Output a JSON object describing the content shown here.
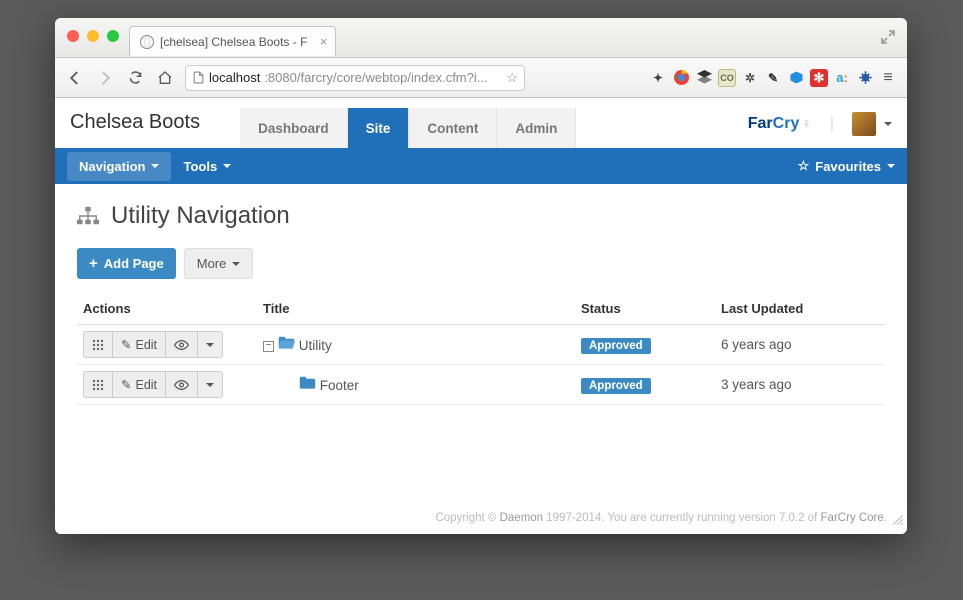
{
  "browser": {
    "tab_title": "[chelsea] Chelsea Boots - F",
    "url_host": "localhost",
    "url_rest": ":8080/farcry/core/webtop/index.cfm?i..."
  },
  "header": {
    "brand": "Chelsea Boots",
    "tabs": [
      "Dashboard",
      "Site",
      "Content",
      "Admin"
    ],
    "logo_far": "Far",
    "logo_cry": "Cry"
  },
  "subnav": {
    "navigation": "Navigation",
    "tools": "Tools",
    "favourites": "Favourites"
  },
  "page": {
    "title": "Utility Navigation",
    "add_page": "Add Page",
    "more": "More"
  },
  "table": {
    "headers": {
      "actions": "Actions",
      "title": "Title",
      "status": "Status",
      "updated": "Last Updated"
    },
    "edit": "Edit",
    "rows": [
      {
        "indent": 0,
        "expander": true,
        "open": true,
        "title": "Utility",
        "status": "Approved",
        "updated": "6 years ago"
      },
      {
        "indent": 1,
        "expander": false,
        "open": false,
        "title": "Footer",
        "status": "Approved",
        "updated": "3 years ago"
      }
    ]
  },
  "footer": {
    "copyright": "Copyright © ",
    "daemon": "Daemon",
    "mid": " 1997-2014. You are currently running version 7.0.2 of ",
    "product": "FarCry Core",
    "end": "."
  }
}
